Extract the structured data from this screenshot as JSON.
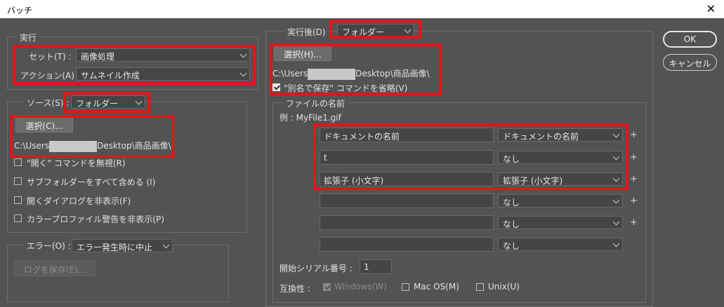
{
  "window": {
    "title": "バッチ",
    "close_glyph": "✕"
  },
  "play": {
    "legend": "実行",
    "set_label": "セット(T) :",
    "set_value": "画像処理",
    "action_label": "アクション(A) :",
    "action_value": "サムネイル作成"
  },
  "source": {
    "label": "ソース(S) :",
    "value": "フォルダー",
    "choose_button": "選択(C)...",
    "path_prefix": "C:\\Users",
    "path_suffix": "Desktop\\商品画像\\",
    "options": [
      "\"開く\" コマンドを無視(R)",
      "サブフォルダーをすべて含める (I)",
      "開くダイアログを非表示(F)",
      "カラープロファイル警告を非表示(P)"
    ]
  },
  "errors": {
    "label": "エラー(O) :",
    "value": "エラー発生時に中止",
    "save_log_button": "ログを保存(E)..."
  },
  "destination": {
    "label": "実行後(D)",
    "value": "フォルダー",
    "choose_button": "選択(H)...",
    "path_prefix": "C:\\Users",
    "path_suffix": "Desktop\\商品画像\\",
    "override_save": "\"別名で保存\" コマンドを省略(V)"
  },
  "file_naming": {
    "legend": "ファイルの名前",
    "example": "例 : MyFile1.gif",
    "rows": [
      {
        "text": "ドキュメントの名前",
        "select": "ドキュメントの名前",
        "plus": "+"
      },
      {
        "text": "t",
        "select": "なし",
        "plus": "+"
      },
      {
        "text": "拡張子 (小文字)",
        "select": "拡張子 (小文字)",
        "plus": "+"
      },
      {
        "text": "",
        "select": "なし",
        "plus": "+"
      },
      {
        "text": "",
        "select": "なし",
        "plus": "+"
      },
      {
        "text": "",
        "select": "なし",
        "plus": ""
      }
    ],
    "serial_label": "開始シリアル番号 :",
    "serial_value": "1",
    "compat_label": "互換性 :",
    "compat_windows": "Windows(W)",
    "compat_mac": "Mac OS(M)",
    "compat_unix": "Unix(U)"
  },
  "buttons": {
    "ok": "OK",
    "cancel": "キャンセル"
  },
  "colors": {
    "highlight": "#e3151a",
    "dialog_bg": "#535353"
  }
}
